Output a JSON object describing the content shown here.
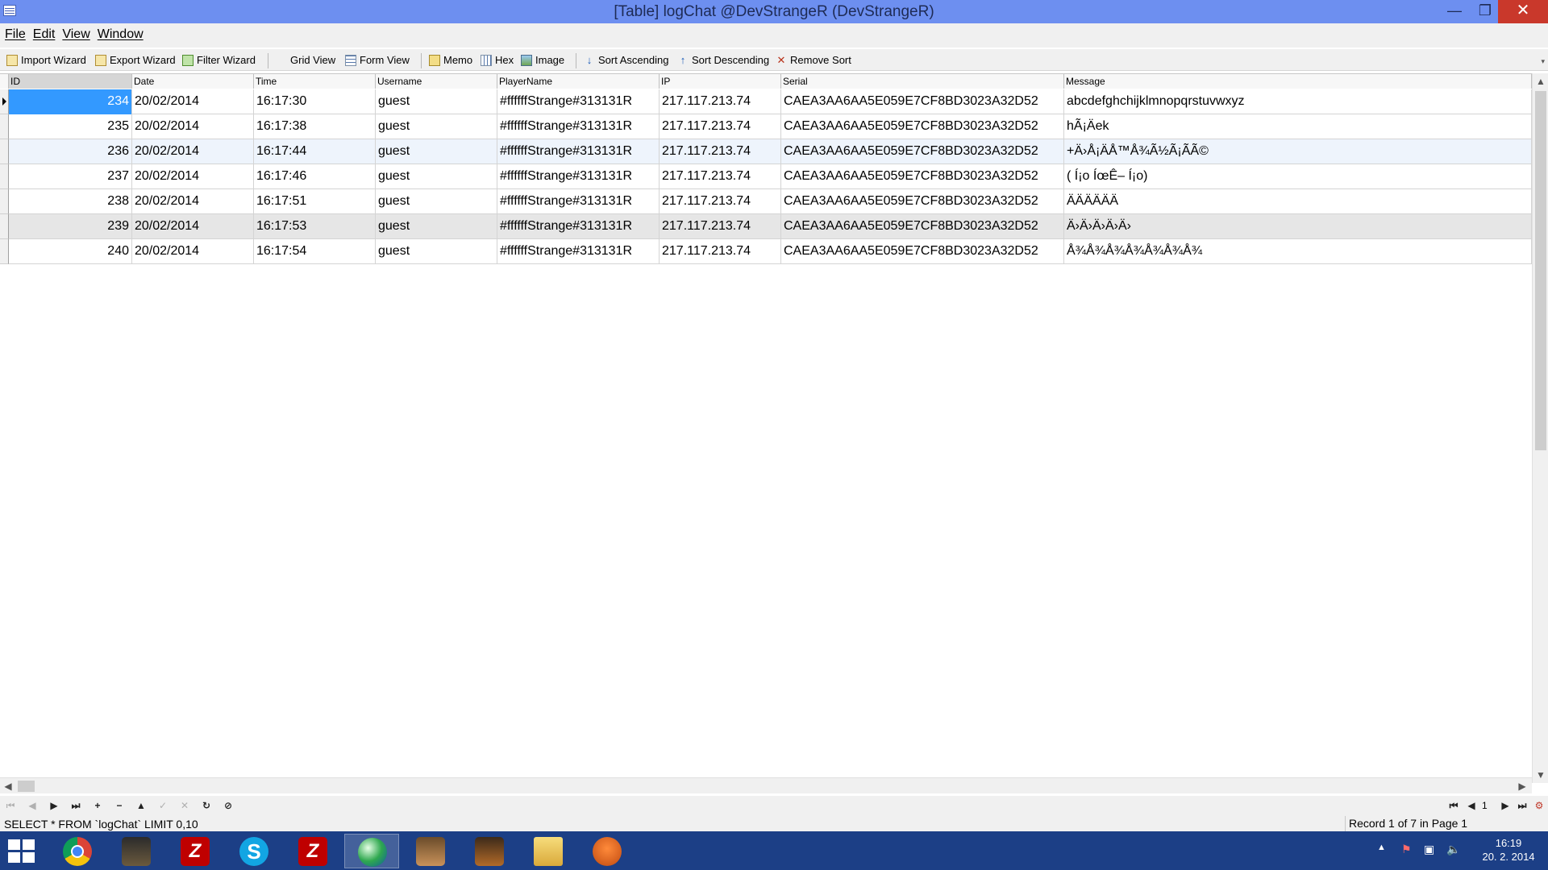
{
  "window": {
    "title": "[Table] logChat @DevStrangeR (DevStrangeR)",
    "minimize_glyph": "—",
    "maximize_glyph": "❐",
    "close_glyph": "✕"
  },
  "menu": [
    "File",
    "Edit",
    "View",
    "Window"
  ],
  "toolbar": {
    "import_wizard": "Import Wizard",
    "export_wizard": "Export Wizard",
    "filter_wizard": "Filter Wizard",
    "grid_view": "Grid View",
    "form_view": "Form View",
    "memo": "Memo",
    "hex": "Hex",
    "image": "Image",
    "sort_ascending": "Sort Ascending",
    "sort_descending": "Sort Descending",
    "remove_sort": "Remove Sort"
  },
  "table": {
    "columns": [
      "ID",
      "Date",
      "Time",
      "Username",
      "PlayerName",
      "IP",
      "Serial",
      "Message"
    ],
    "rows": [
      [
        "234",
        "20/02/2014",
        "16:17:30",
        "guest",
        "#ffffffStrange#313131R",
        "217.117.213.74",
        "CAEA3AA6AA5E059E7CF8BD3023A32D52",
        "abcdefghchijklmnopqrstuvwxyz"
      ],
      [
        "235",
        "20/02/2014",
        "16:17:38",
        "guest",
        "#ffffffStrange#313131R",
        "217.117.213.74",
        "CAEA3AA6AA5E059E7CF8BD3023A32D52",
        "hÃ¡Äek"
      ],
      [
        "236",
        "20/02/2014",
        "16:17:44",
        "guest",
        "#ffffffStrange#313131R",
        "217.117.213.74",
        "CAEA3AA6AA5E059E7CF8BD3023A32D52",
        "+Ä›Å¡ÄÅ™Å¾Ã½Ã¡Ã­Ã©"
      ],
      [
        "237",
        "20/02/2014",
        "16:17:46",
        "guest",
        "#ffffffStrange#313131R",
        "217.117.213.74",
        "CAEA3AA6AA5E059E7CF8BD3023A32D52",
        "( Í¡o ÍœÊ– Í¡o)"
      ],
      [
        "238",
        "20/02/2014",
        "16:17:51",
        "guest",
        "#ffffffStrange#313131R",
        "217.117.213.74",
        "CAEA3AA6AA5E059E7CF8BD3023A32D52",
        "ÄÄÄÄÄÄ"
      ],
      [
        "239",
        "20/02/2014",
        "16:17:53",
        "guest",
        "#ffffffStrange#313131R",
        "217.117.213.74",
        "CAEA3AA6AA5E059E7CF8BD3023A32D52",
        "Ä›Ä›Ä›Ä›Ä›"
      ],
      [
        "240",
        "20/02/2014",
        "16:17:54",
        "guest",
        "#ffffffStrange#313131R",
        "217.117.213.74",
        "CAEA3AA6AA5E059E7CF8BD3023A32D52",
        "Å¾Å¾Å¾Å¾Å¾Å¾Å¾"
      ]
    ],
    "selected_row": 0
  },
  "navigator": {
    "page": "1"
  },
  "status": {
    "sql": "SELECT * FROM `logChat` LIMIT 0,10",
    "record": "Record 1 of 7 in Page 1"
  },
  "taskbar": {
    "clock_time": "16:19",
    "clock_date": "20. 2. 2014",
    "apps": [
      "chrome-icon",
      "dark-app-icon",
      "filezilla-icon",
      "skype-icon",
      "filezilla-server-icon",
      "globe-app-icon",
      "cowboy-game-icon",
      "game-icon",
      "file-explorer-icon",
      "glove-app-icon"
    ]
  },
  "colors": {
    "titlebar": "#6d8ff0",
    "close_button": "#c9382b",
    "selection": "#3399ff",
    "taskbar": "#1c3f86"
  }
}
